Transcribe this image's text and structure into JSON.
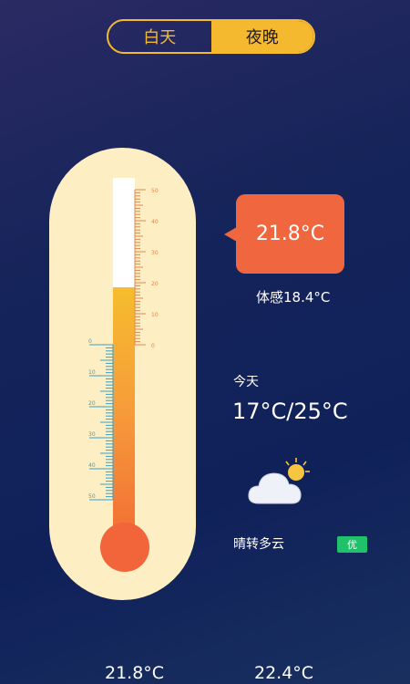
{
  "toggle": {
    "day_label": "白天",
    "night_label": "夜晚",
    "selected": "夜晚"
  },
  "thermometer": {
    "current_celsius": 21.8,
    "right_scale_ticks": [
      "50",
      "40",
      "30",
      "20",
      "10",
      "0"
    ],
    "left_scale_ticks": [
      "0",
      "10",
      "20",
      "30",
      "40",
      "50"
    ],
    "colors": {
      "body": "#fdeec4",
      "fill_top": "#f6bd2e",
      "fill_bottom": "#f26d35",
      "right_scale": "#e2884b",
      "left_scale": "#3aa0c8"
    }
  },
  "current": {
    "temp": "21.8°C",
    "feels_like": "体感18.4°C"
  },
  "today": {
    "label": "今天",
    "range": "17°C/25°C",
    "condition": "晴转多云",
    "air_quality": "优"
  },
  "footer": {
    "left_value": "21.8°C",
    "right_value": "22.4°C"
  },
  "colors": {
    "accent": "#f4b92f",
    "bubble": "#f0663f",
    "aqi_badge": "#1fc16a"
  }
}
